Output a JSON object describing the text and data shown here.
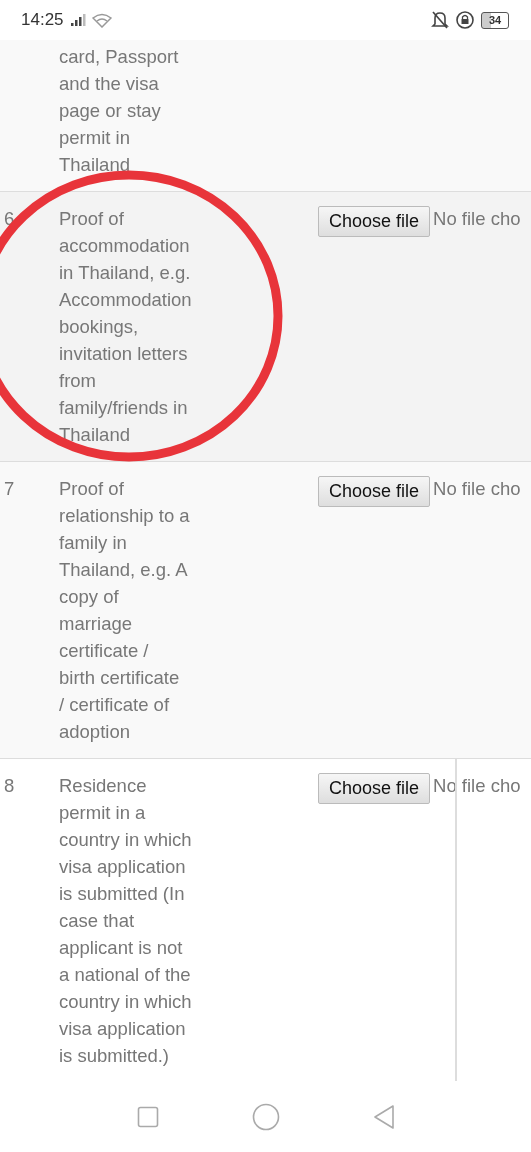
{
  "status_bar": {
    "time": "14:25",
    "battery": "34"
  },
  "rows": [
    {
      "number": "",
      "text": "card, Passport\nand the visa\npage or stay\npermit in\nThailand",
      "cut_top": true,
      "button": "",
      "file_status": "",
      "color": "#f9f9f9",
      "divider": false
    },
    {
      "number": "6",
      "text": "Proof of\naccommodation\nin Thailand, e.g.\nAccommodation\nbookings,\ninvitation letters\nfrom\nfamily/friends in\nThailand",
      "cut_top": false,
      "button": "Choose file",
      "file_status": "No file cho",
      "color": "#f3f3f3",
      "divider": false
    },
    {
      "number": "7",
      "text": "Proof of\nrelationship to a\nfamily in\nThailand, e.g. A\ncopy of\nmarriage\ncertificate /\nbirth certificate\n/ certificate of\nadoption",
      "cut_top": false,
      "button": "Choose file",
      "file_status": "No file cho",
      "color": "#f9f9f9",
      "divider": false
    },
    {
      "number": "8",
      "text": "Residence\npermit in a\ncountry in which\nvisa application\nis submitted (In\ncase that\napplicant is not\na national of the\ncountry in which\nvisa application\nis submitted.)",
      "cut_top": false,
      "button": "Choose file",
      "file_status": "No file cho",
      "color": "#ffffff",
      "divider": true
    }
  ],
  "annotation": {
    "kind": "circle",
    "color": "#e8343a"
  }
}
